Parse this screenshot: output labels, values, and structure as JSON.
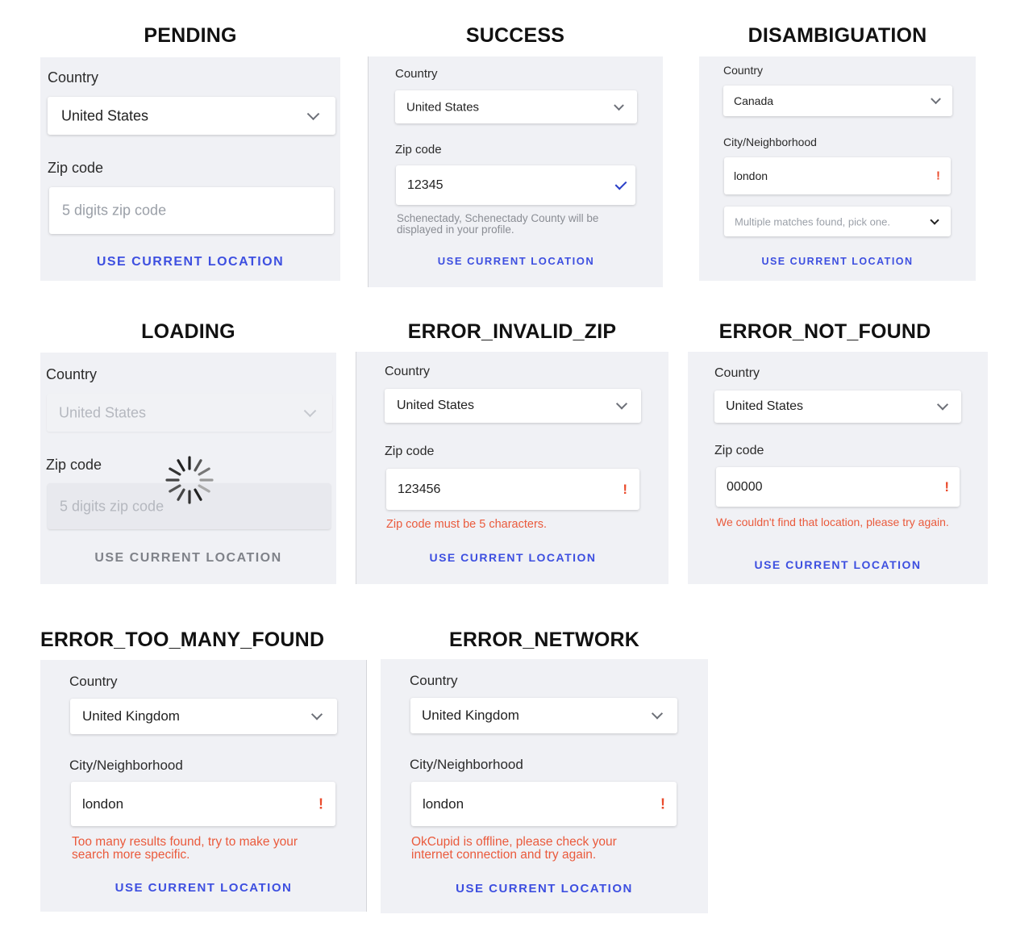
{
  "titles": {
    "pending": "PENDING",
    "success": "SUCCESS",
    "disambiguation": "DISAMBIGUATION",
    "loading": "LOADING",
    "error_invalid_zip": "ERROR_INVALID_ZIP",
    "error_not_found": "ERROR_NOT_FOUND",
    "error_too_many_found": "ERROR_TOO_MANY_FOUND",
    "error_network": "ERROR_NETWORK"
  },
  "labels": {
    "country": "Country",
    "zip_code": "Zip code",
    "city": "City/Neighborhood",
    "use_current_location": "USE CURRENT LOCATION",
    "zip_placeholder": "5 digits zip code"
  },
  "pending": {
    "country": "United States",
    "zip_value": ""
  },
  "success": {
    "country": "United States",
    "zip_value": "12345",
    "help": "Schenectady, Schenectady County will be displayed in your profile."
  },
  "disambiguation": {
    "country": "Canada",
    "city_value": "london",
    "matches_placeholder": "Multiple matches found, pick one."
  },
  "loading": {
    "country": "United States",
    "zip_value": ""
  },
  "error_invalid_zip": {
    "country": "United States",
    "zip_value": "123456",
    "error": "Zip code must be 5 characters."
  },
  "error_not_found": {
    "country": "United States",
    "zip_value": "00000",
    "error": "We couldn't find that location, please try again."
  },
  "error_too_many_found": {
    "country": "United Kingdom",
    "city_value": "london",
    "error": "Too many results found, try to make your search more specific."
  },
  "error_network": {
    "country": "United Kingdom",
    "city_value": "london",
    "error": "OkCupid is offline, please check your internet connection and try again."
  },
  "colors": {
    "panel_bg": "#f0f1f5",
    "link": "#3d4fe0",
    "error": "#ea5a3c",
    "check": "#2a3fc8"
  }
}
